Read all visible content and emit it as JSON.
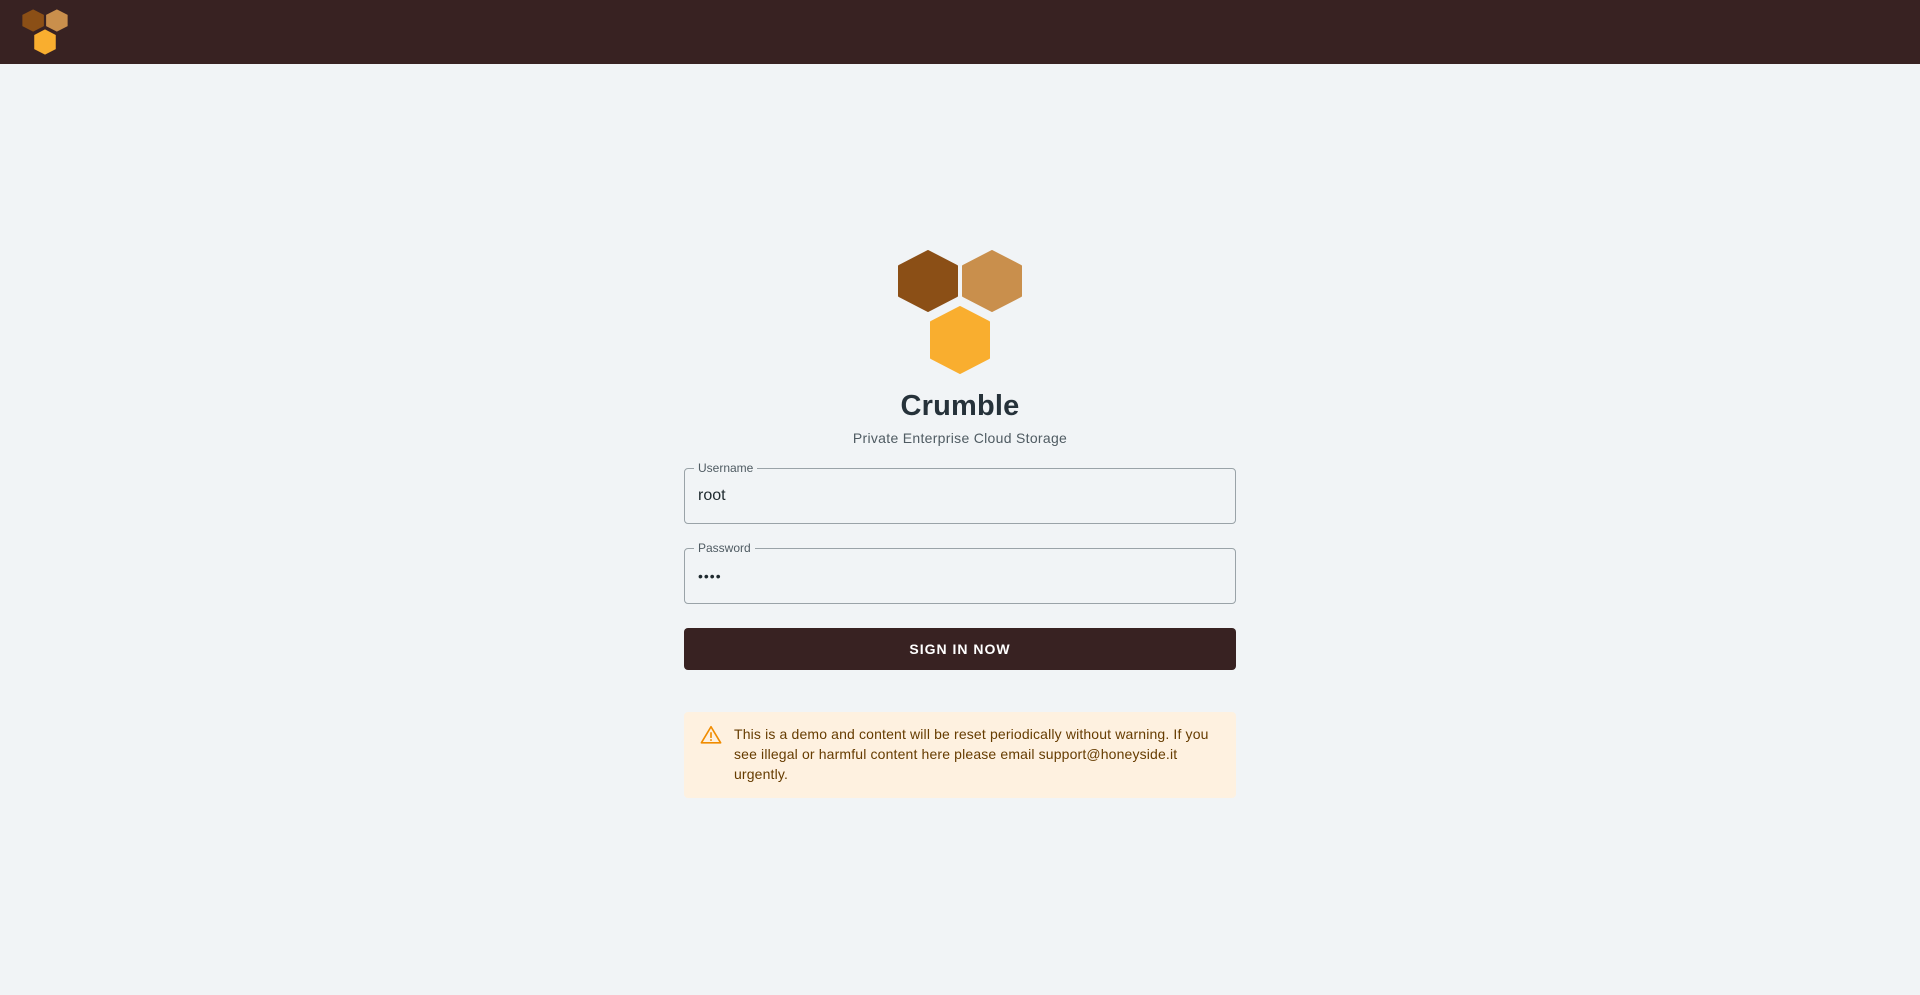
{
  "brand": {
    "name": "Crumble",
    "tagline": "Private Enterprise Cloud Storage",
    "colors": {
      "topbar": "#382222",
      "hex_dark": "#8b4f16",
      "hex_tan": "#c98f4c",
      "hex_gold": "#f9ae2f"
    }
  },
  "topbar": {
    "logo_icon": "honeycomb-logo-icon"
  },
  "login": {
    "username": {
      "label": "Username",
      "value": "root"
    },
    "password": {
      "label": "Password",
      "value": "••••"
    },
    "submit_label": "SIGN IN NOW"
  },
  "alert": {
    "icon": "warning-icon",
    "message": "This is a demo and content will be reset periodically without warning. If you see illegal or harmful content here please email support@honeyside.it urgently."
  }
}
